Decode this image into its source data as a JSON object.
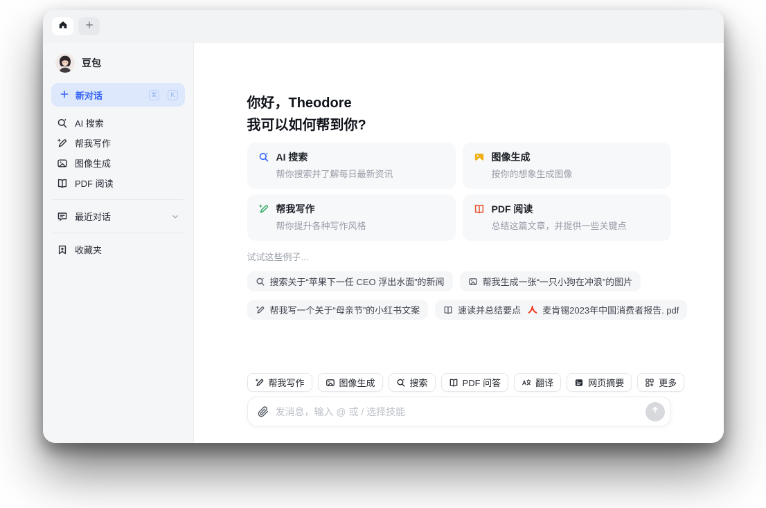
{
  "tabbar": {
    "home_icon": "home-icon",
    "new_tab_icon": "plus-icon"
  },
  "sidebar": {
    "profile": {
      "name": "豆包",
      "avatar_icon": "girl-avatar"
    },
    "new_chat": {
      "label": "新对话",
      "icon": "plus-icon",
      "shortcut": [
        "⌘",
        "K"
      ]
    },
    "items": [
      {
        "label": "AI 搜索",
        "icon": "search-icon"
      },
      {
        "label": "帮我写作",
        "icon": "pen-icon"
      },
      {
        "label": "图像生成",
        "icon": "image-icon"
      },
      {
        "label": "PDF 阅读",
        "icon": "book-icon"
      }
    ],
    "recent": {
      "label": "最近对话",
      "icon": "chat-icon",
      "chevron": "chevron-down-icon"
    },
    "favorites": {
      "label": "收藏夹",
      "icon": "bookmark-icon"
    }
  },
  "main": {
    "greeting_line1": "你好，Theodore",
    "greeting_line2": "我可以如何帮到你?",
    "cards": [
      {
        "title": "AI 搜索",
        "subtitle": "帮你搜索并了解每日最新资讯",
        "icon": "search-icon",
        "color": "#3b6bfc"
      },
      {
        "title": "图像生成",
        "subtitle": "按你的想象生成图像",
        "icon": "image-icon",
        "color": "#f0b114"
      },
      {
        "title": "帮我写作",
        "subtitle": "帮你提升各种写作风格",
        "icon": "pen-icon",
        "color": "#2faa5e"
      },
      {
        "title": "PDF 阅读",
        "subtitle": "总结这篇文章，并提供一些关键点",
        "icon": "book-icon",
        "color": "#e8512e"
      }
    ],
    "examples_label": "试试这些例子...",
    "examples": [
      {
        "label": "搜索关于“苹果下一任 CEO 浮出水面”的新闻",
        "icon": "search-icon"
      },
      {
        "label": "帮我生成一张“一只小狗在冲浪”的图片",
        "icon": "image-icon"
      },
      {
        "label": "帮我写一个关于“母亲节”的小红书文案",
        "icon": "pen-icon"
      },
      {
        "label": "速读并总结要点",
        "icon": "book-icon",
        "file": "麦肯锡2023年中国消费者报告. pdf",
        "file_icon": "pdf-icon",
        "file_color": "#ee3b23"
      }
    ],
    "skills": [
      {
        "label": "帮我写作",
        "icon": "pen-icon"
      },
      {
        "label": "图像生成",
        "icon": "image-icon"
      },
      {
        "label": "搜索",
        "icon": "search-icon"
      },
      {
        "label": "PDF 问答",
        "icon": "book-icon"
      },
      {
        "label": "翻译",
        "icon": "translate-icon"
      },
      {
        "label": "网页摘要",
        "icon": "webpage-icon"
      },
      {
        "label": "更多",
        "icon": "more-grid-icon"
      }
    ],
    "input": {
      "placeholder": "发消息，输入 @ 或 / 选择技能",
      "attach_icon": "paperclip-icon",
      "send_icon": "arrow-up-icon"
    }
  },
  "colors": {
    "accent_blue": "#3866f2",
    "new_chat_bg": "#dde8fd",
    "sidebar_bg": "#f5f6f8",
    "card_bg": "#f7f8fa",
    "icon_yellow": "#f0b114",
    "icon_green": "#2faa5e",
    "icon_red": "#e8512e",
    "pdf_red": "#ee3b23"
  }
}
